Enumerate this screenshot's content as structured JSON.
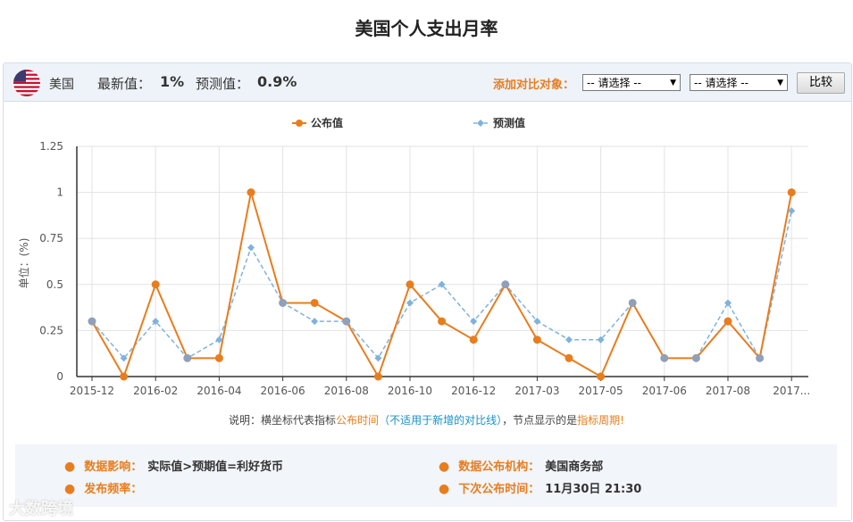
{
  "page": {
    "title": "美国个人支出月率"
  },
  "header": {
    "country": "美国",
    "latest_label": "最新值：",
    "latest_value": "1%",
    "forecast_label": "预测值：",
    "forecast_value": "0.9%",
    "compare_label": "添加对比对象：",
    "select1": "-- 请选择 --",
    "select2": "-- 请选择 --",
    "compare_button": "比较"
  },
  "note": {
    "part1": "说明：横坐标代表指标",
    "part2": "公布时间",
    "part3": "（不适用于新增的对比线）",
    "part4": "，节点显示的是",
    "part5": "指标周期",
    "part6": "!"
  },
  "info": {
    "impact_label": "数据影响：",
    "impact_value": "实际值>预期值=利好货币",
    "agency_label": "数据公布机构：",
    "agency_value": "美国商务部",
    "freq_label": "发布频率：",
    "freq_value": "",
    "next_label": "下次公布时间：",
    "next_value": "11月30日 21:30"
  },
  "watermark": "大数跨境",
  "colors": {
    "actual": "#e87d1e",
    "forecast": "#7fb2dd",
    "grid": "#e3e3e3",
    "axis": "#333333"
  },
  "chart_data": {
    "type": "line",
    "ylabel": "单位：(%)",
    "ylim": [
      0,
      1.25
    ],
    "yticks": [
      "0",
      "0.25",
      "0.5",
      "0.75",
      "1",
      "1.25"
    ],
    "xticks": [
      "2015-12",
      "2016-02",
      "2016-04",
      "2016-06",
      "2016-08",
      "2016-10",
      "2016-12",
      "2017-03",
      "2017-05",
      "2017-06",
      "2017-08",
      "2017..."
    ],
    "grid": true,
    "legend_position": "top",
    "series": [
      {
        "name": "公布值",
        "style": "solid",
        "values": [
          0.3,
          0,
          0.5,
          0.1,
          0.1,
          1,
          0.4,
          0.4,
          0.3,
          0,
          0.5,
          0.3,
          0.2,
          0.5,
          0.2,
          0.1,
          0,
          0.4,
          0.1,
          0.1,
          0.3,
          0.1,
          1
        ]
      },
      {
        "name": "预测值",
        "style": "dashed",
        "values": [
          0.3,
          0.1,
          0.3,
          0.1,
          0.2,
          0.7,
          0.4,
          0.3,
          0.3,
          0.1,
          0.4,
          0.5,
          0.3,
          0.5,
          0.3,
          0.2,
          0.2,
          0.4,
          0.1,
          0.1,
          0.4,
          0.1,
          0.9
        ]
      }
    ]
  }
}
